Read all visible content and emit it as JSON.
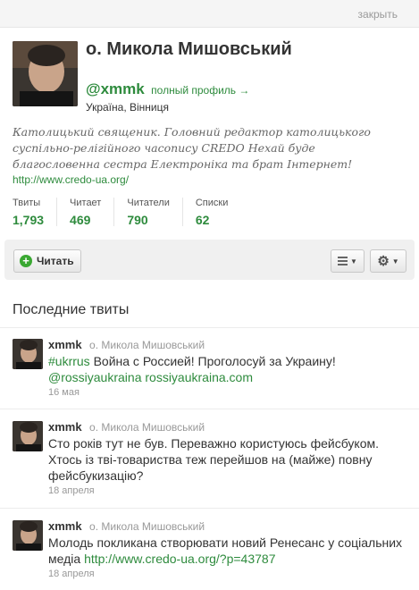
{
  "header": {
    "close_label": "закрыть"
  },
  "profile": {
    "name": "о. Микола Мишовський",
    "handle": "@xmmk",
    "full_profile_link": "полный профиль →",
    "location": "Україна, Вінниця",
    "bio": "Католицький священик. Головний редактор католицького суспільно-релігійного часопису CREDO Нехай буде благословенна сестра Електроніка та брат Інтернет!",
    "url": "http://www.credo-ua.org/"
  },
  "stats": [
    {
      "label": "Твиты",
      "value": "1,793"
    },
    {
      "label": "Читает",
      "value": "469"
    },
    {
      "label": "Читатели",
      "value": "790"
    },
    {
      "label": "Списки",
      "value": "62"
    }
  ],
  "actions": {
    "follow_label": "Читать"
  },
  "timeline": {
    "title": "Последние твиты",
    "tweets": [
      {
        "user": "xmmk",
        "name": "о. Микола Мишовський",
        "hashtag": "#ukrrus",
        "text_after_hashtag": " Война с Россией! Проголосуй за Украину!",
        "mention": "@rossiyaukraina",
        "link": "rossiyaukraina.com",
        "date": "16 мая"
      },
      {
        "user": "xmmk",
        "name": "о. Микола Мишовський",
        "text": "Сто років тут не був. Переважно користуюсь фейсбуком. Хтось із тві-товариства теж перейшов на (майже) повну фейсбукизацію?",
        "date": "18 апреля"
      },
      {
        "user": "xmmk",
        "name": "о. Микола Мишовський",
        "text": "Молодь покликана створювати новий Ренесанс у соціальних медіа ",
        "link": "http://www.credo-ua.org/?p=43787",
        "date": "18 апреля"
      }
    ]
  }
}
